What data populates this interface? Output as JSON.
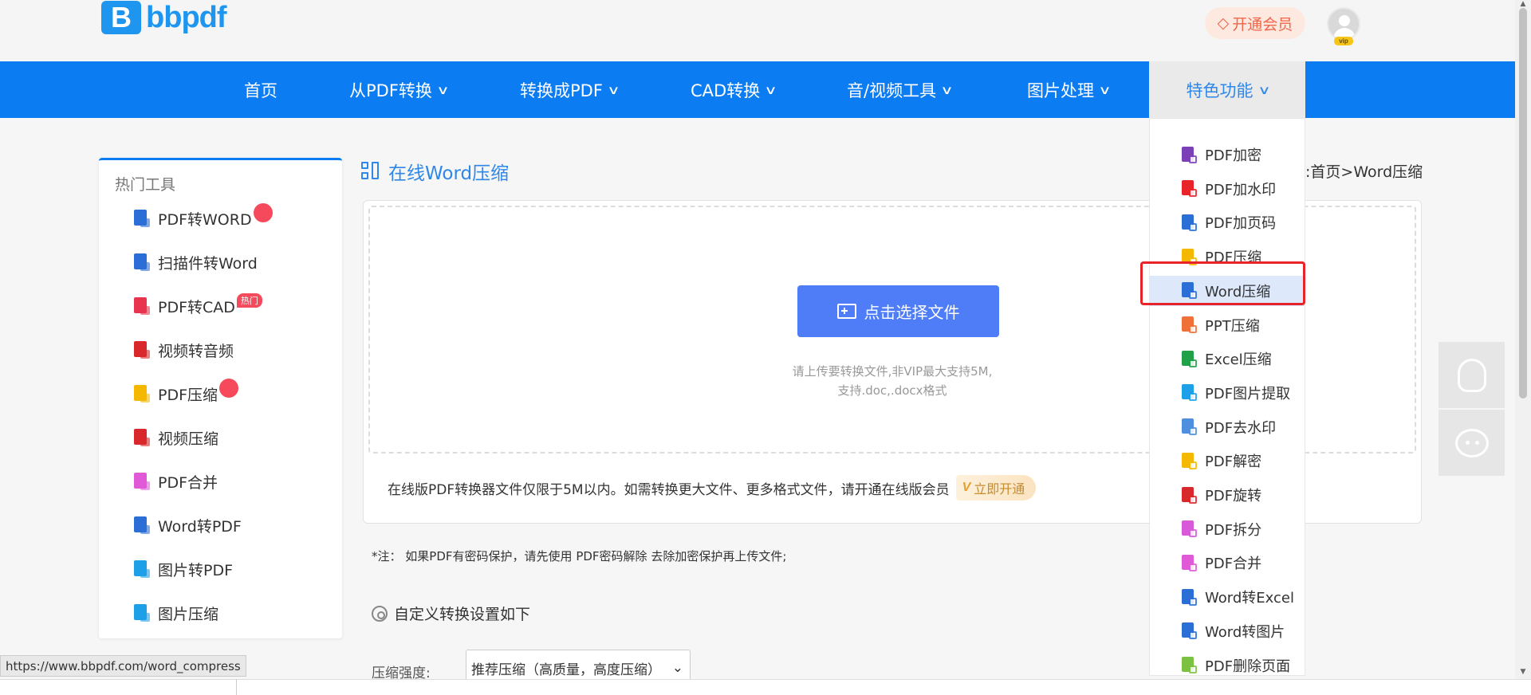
{
  "header": {
    "logo_letter": "B",
    "logo_text_a": "bb",
    "logo_text_b": "pdf",
    "vip_button": "开通会员",
    "avatar_badge": "vip"
  },
  "nav": {
    "items": [
      {
        "label": "首页",
        "has_chevron": false
      },
      {
        "label": "从PDF转换",
        "has_chevron": true
      },
      {
        "label": "转换成PDF",
        "has_chevron": true
      },
      {
        "label": "CAD转换",
        "has_chevron": true
      },
      {
        "label": "音/视频工具",
        "has_chevron": true
      },
      {
        "label": "图片处理",
        "has_chevron": true
      },
      {
        "label": "特色功能",
        "has_chevron": true,
        "active": true
      }
    ],
    "chevron": "∨"
  },
  "sidebar": {
    "title": "热门工具",
    "items": [
      {
        "label": "PDF转WORD",
        "badge": "fire",
        "icon": "pdf-to-word-icon",
        "color": "#2b6fd6"
      },
      {
        "label": "扫描件转Word",
        "icon": "scan-to-word-icon",
        "color": "#2b6fd6"
      },
      {
        "label": "PDF转CAD",
        "badge": "热门",
        "icon": "pdf-to-cad-icon",
        "color": "#e8344e"
      },
      {
        "label": "视频转音频",
        "icon": "video-to-audio-icon",
        "color": "#d8282c"
      },
      {
        "label": "PDF压缩",
        "badge": "fire",
        "icon": "pdf-compress-icon",
        "color": "#f5b800"
      },
      {
        "label": "视频压缩",
        "icon": "video-compress-icon",
        "color": "#d8282c"
      },
      {
        "label": "PDF合并",
        "icon": "pdf-merge-icon",
        "color": "#e05ad8"
      },
      {
        "label": "Word转PDF",
        "icon": "word-to-pdf-icon",
        "color": "#2b6fd6"
      },
      {
        "label": "图片转PDF",
        "icon": "image-to-pdf-icon",
        "color": "#1ea0e8"
      },
      {
        "label": "图片压缩",
        "icon": "image-compress-icon",
        "color": "#1ea0e8"
      }
    ]
  },
  "main": {
    "title": "在线Word压缩",
    "breadcrumb": ":首页>Word压缩",
    "select_button": "点击选择文件",
    "hint_line1": "请上传要转换文件,非VIP最大支持5M,",
    "hint_line2": "支持.doc,.docx格式",
    "limit_note": "在线版PDF转换器文件仅限于5M以内。如需转换更大文件、更多格式文件，请开通在线版会员",
    "open_now": "立即开通",
    "note_prefix": "*注：",
    "note_text": "如果PDF有密码保护，请先使用",
    "note_link": "PDF密码解除",
    "note_suffix": "去除加密保护再上传文件;",
    "settings_title": "自定义转换设置如下",
    "compress_label": "压缩强度:",
    "compress_value": "推荐压缩（高质量，高度压缩）"
  },
  "dropdown": {
    "items": [
      {
        "label": "PDF加密",
        "color": "#7b3fb8"
      },
      {
        "label": "PDF加水印",
        "color": "#e8232a"
      },
      {
        "label": "PDF加页码",
        "color": "#2b6fd6"
      },
      {
        "label": "PDF压缩",
        "color": "#f5b800"
      },
      {
        "label": "Word压缩",
        "color": "#2b6fd6",
        "selected": true
      },
      {
        "label": "PPT压缩",
        "color": "#f0703a"
      },
      {
        "label": "Excel压缩",
        "color": "#20a148"
      },
      {
        "label": "PDF图片提取",
        "color": "#1ea0e8"
      },
      {
        "label": "PDF去水印",
        "color": "#4f8fe0"
      },
      {
        "label": "PDF解密",
        "color": "#f5b800"
      },
      {
        "label": "PDF旋转",
        "color": "#d8282c"
      },
      {
        "label": "PDF拆分",
        "color": "#d85ad8"
      },
      {
        "label": "PDF合并",
        "color": "#e05ad8"
      },
      {
        "label": "Word转Excel",
        "color": "#2b6fd6"
      },
      {
        "label": "Word转图片",
        "color": "#2b6fd6"
      },
      {
        "label": "PDF删除页面",
        "color": "#7cc242"
      }
    ]
  },
  "status_url": "https://www.bbpdf.com/word_compress",
  "colors": {
    "brand_blue": "#0c7cf3",
    "button_blue": "#4f7cf7",
    "highlight_red": "#e8232a",
    "vip_orange": "#f0664a"
  }
}
